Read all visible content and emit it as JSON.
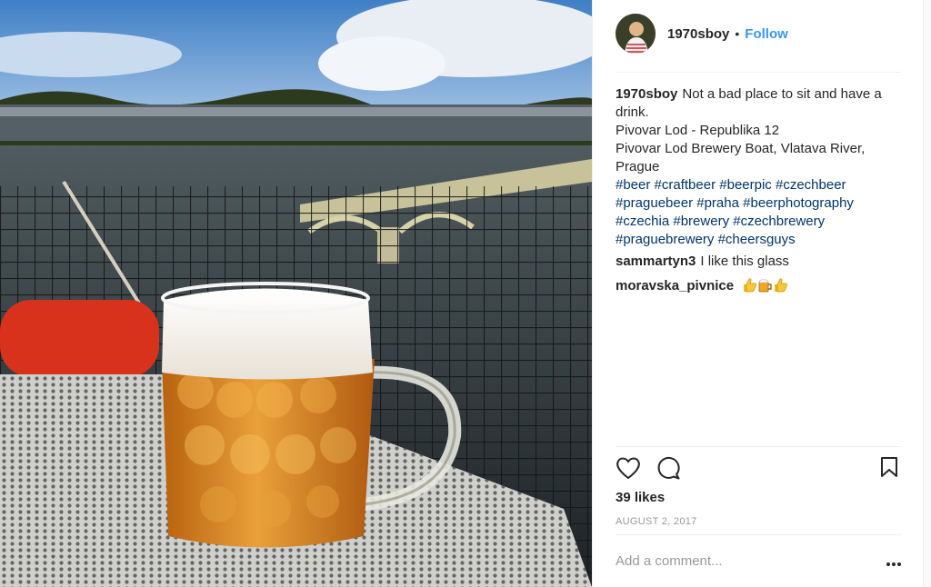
{
  "post": {
    "username": "1970sboy",
    "separator": "•",
    "follow_label": "Follow",
    "caption_text": "Not a bad place to sit and have a drink.",
    "caption_lines": [
      "Pivovar Lod - Republika 12",
      "Pivovar Lod Brewery Boat, Vlatava River, Prague"
    ],
    "hashtags": [
      "#beer",
      "#craftbeer",
      "#beerpic",
      "#czechbeer",
      "#praguebeer",
      "#praha",
      "#beerphotography",
      "#czechia",
      "#brewery",
      "#czechbrewery",
      "#praguebrewery",
      "#cheersguys"
    ],
    "comments": [
      {
        "user": "sammartyn3",
        "text": "I like this glass"
      },
      {
        "user": "moravska_pivnice",
        "text": "",
        "emojis": [
          "thumbs-up",
          "beer-mug",
          "thumbs-up"
        ]
      }
    ],
    "likes": "39 likes",
    "date": "AUGUST 2, 2017",
    "add_comment_placeholder": "Add a comment...",
    "more_label": "•••"
  },
  "icons": {
    "like": "heart-icon",
    "comment": "comment-bubble-icon",
    "save": "bookmark-icon",
    "more": "more-options-icon"
  },
  "colors": {
    "link": "#3897f0",
    "hashtag": "#003569",
    "muted": "#999999",
    "text": "#262626"
  }
}
